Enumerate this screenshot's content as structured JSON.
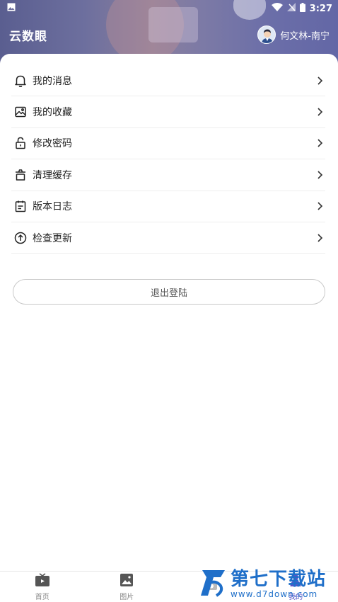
{
  "status_bar": {
    "time": "3:27"
  },
  "app": {
    "title": "云数眼"
  },
  "user": {
    "name": "何文林-南宁"
  },
  "menu": [
    {
      "label": "我的消息",
      "icon": "bell-icon"
    },
    {
      "label": "我的收藏",
      "icon": "image-icon"
    },
    {
      "label": "修改密码",
      "icon": "lock-icon"
    },
    {
      "label": "清理缓存",
      "icon": "trash-icon"
    },
    {
      "label": "版本日志",
      "icon": "calendar-icon"
    },
    {
      "label": "检查更新",
      "icon": "arrow-up-circle-icon"
    }
  ],
  "logout_label": "退出登陆",
  "bottom_nav": [
    {
      "label": "首页",
      "icon": "tv-icon"
    },
    {
      "label": "图片",
      "icon": "picture-icon"
    },
    {
      "label": "",
      "icon": "camera-icon"
    },
    {
      "label": "我的",
      "icon": "person-icon",
      "active": true
    }
  ],
  "watermark": {
    "name": "第七下载站",
    "url": "www.d7down.com"
  },
  "colors": {
    "header": "#6367a6",
    "active_tab": "#5a55c8",
    "watermark": "#1f6fc9"
  }
}
